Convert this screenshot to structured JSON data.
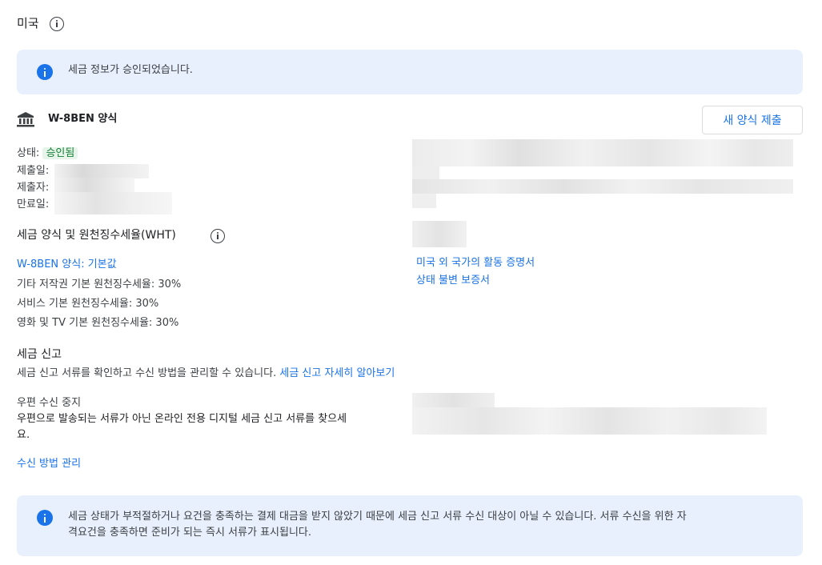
{
  "header": {
    "country": "미국"
  },
  "approved_banner": {
    "text": "세금 정보가 승인되었습니다."
  },
  "form": {
    "title": "W-8BEN 양식",
    "new_form_button": "새 양식 제출",
    "status_label": "상태:",
    "status_value": "승인됨",
    "submitted_date_label": "제출일:",
    "submitter_label": "제출자:",
    "expiry_date_label": "만료일:"
  },
  "wht": {
    "heading": "세금 양식 및 원천징수세율(WHT)",
    "form_link": "W-8BEN 양식: 기본값",
    "rates": [
      "기타 저작권 기본 원천징수세율: 30%",
      "서비스 기본 원천징수세율: 30%",
      "영화 및 TV 기본 원천징수세율: 30%"
    ],
    "cert_link": "미국 외 국가의 활동 증명서",
    "status_link": "상태 불변 보증서"
  },
  "tax_reporting": {
    "heading": "세금 신고",
    "description": "세금 신고 서류를 확인하고 수신 방법을 관리할 수 있습니다.",
    "learn_more_link": "세금 신고 자세히 알아보기",
    "mail_stop_title": "우편 수신 중지",
    "mail_stop_desc_line1": "우편으로 발송되는 서류가 아닌 온라인 전용 디지털 세금 신고 서류를 찾으세",
    "mail_stop_desc_line2": "요.",
    "manage_link": "수신 방법 관리"
  },
  "bottom_banner": {
    "line1": "세금 상태가 부적절하거나 요건을 충족하는 결제 대금을 받지 않았기 때문에 세금 신고 서류 수신 대상이 아닐 수 있습니다. 서류 수신을 위한 자",
    "line2": "격요건을 충족하면 준비가 되는 즉시 서류가 표시됩니다."
  },
  "colors": {
    "accent": "#1a73e8",
    "banner_bg": "#e8f0fe",
    "approved_text": "#188038",
    "approved_bg": "#e6f4ea"
  }
}
